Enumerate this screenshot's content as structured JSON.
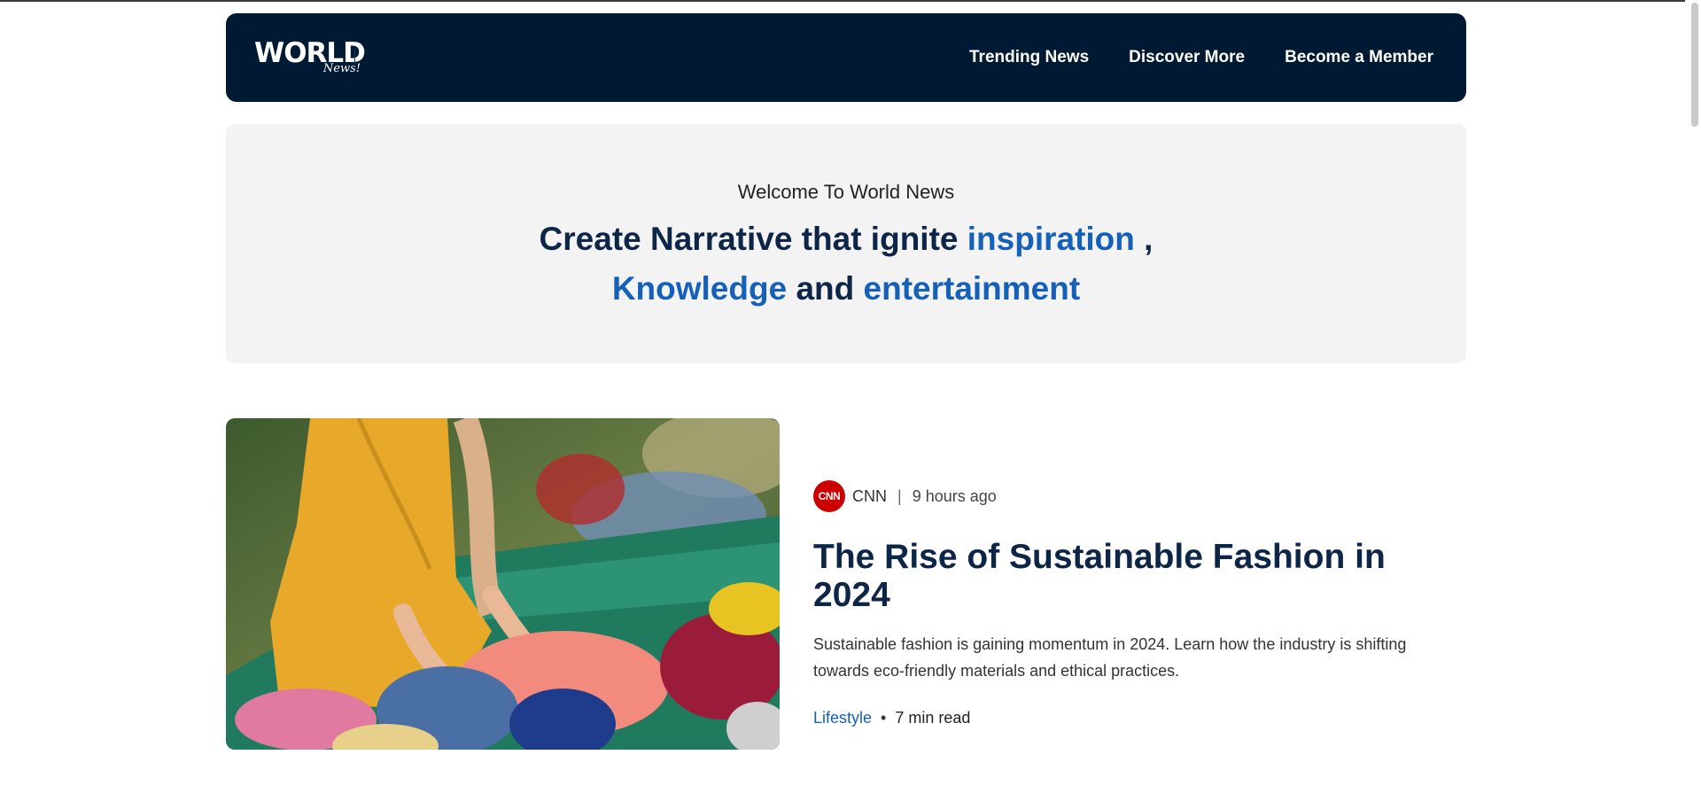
{
  "header": {
    "logo_main": "WORLD",
    "logo_sub": "News!",
    "nav": [
      {
        "label": "Trending News"
      },
      {
        "label": "Discover More"
      },
      {
        "label": "Become a Member"
      }
    ]
  },
  "hero": {
    "welcome": "Welcome To World News",
    "title_part1": "Create Narrative that ignite ",
    "highlight1": "inspiration",
    "title_part2": " ,",
    "highlight2": "Knowledge",
    "title_part3": " and ",
    "highlight3": "entertainment"
  },
  "article": {
    "source_logo": "CNN",
    "source": "CNN",
    "separator": "|",
    "time": "9 hours ago",
    "title": "The Rise of Sustainable Fashion in 2024",
    "summary": "Sustainable fashion is gaining momentum in 2024. Learn how the industry is shifting towards eco-friendly materials and ethical practices.",
    "category": "Lifestyle",
    "dot": "•",
    "read_time": "7 min read"
  },
  "colors": {
    "navbar": "#001a33",
    "accent": "#1560b8",
    "title": "#0d2547",
    "hero_bg": "#f3f3f3"
  }
}
